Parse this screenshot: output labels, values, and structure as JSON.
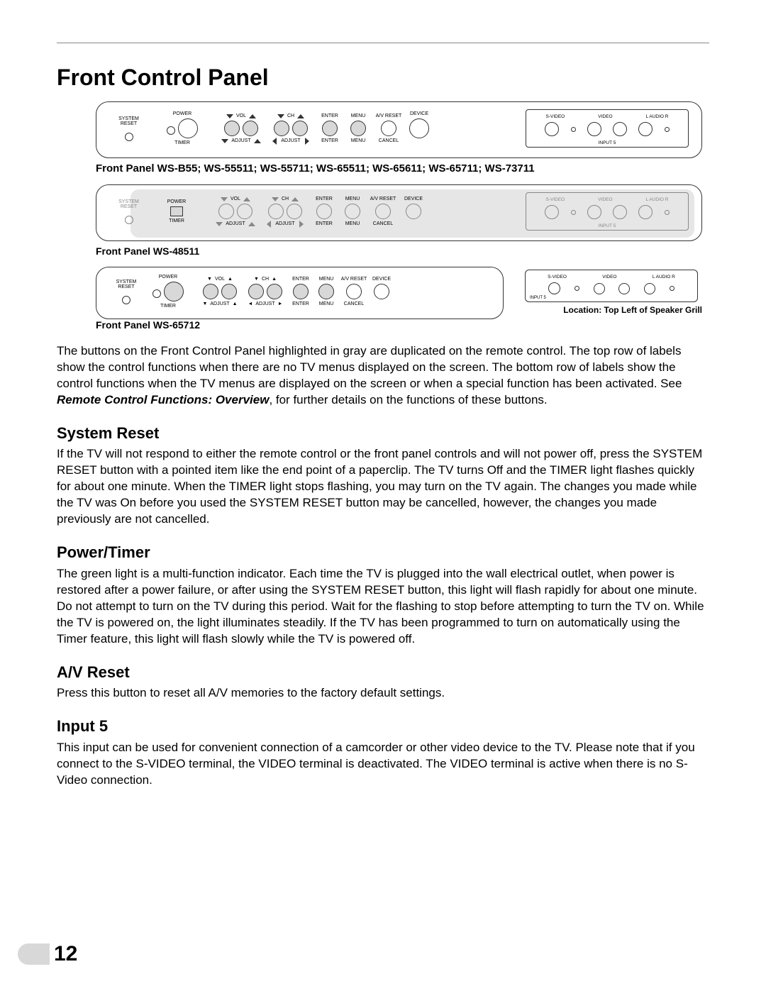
{
  "page_number": "12",
  "main_title": "Front Control Panel",
  "panel1": {
    "caption": "Front Panel WS-B55; WS-55511; WS-55711; WS-65511; WS-65611; WS-65711; WS-73711",
    "system_reset": "SYSTEM\nRESET",
    "power": "POWER",
    "timer": "TIMER",
    "vol": "VOL",
    "ch": "CH",
    "adjust": "ADJUST",
    "enter": "ENTER",
    "menu": "MENU",
    "av_reset": "A/V RESET",
    "device": "DEVICE",
    "cancel": "CANCEL",
    "jacks": {
      "svideo": "S-VIDEO",
      "video": "VIDEO",
      "audio": "L  AUDIO  R",
      "input5": "INPUT 5"
    }
  },
  "panel2": {
    "caption": "Front Panel WS-48511"
  },
  "panel3": {
    "caption": "Front Panel  WS-65712",
    "location": "Location: Top Left of Speaker Grill"
  },
  "paragraphs": {
    "intro_a": "The buttons on the Front Control Panel highlighted in gray are duplicated on the remote control.  The top row of labels show the control functions when there are no TV menus displayed on the screen.  The bottom row of labels show the control functions when the TV menus are displayed on the screen or when a special function has been activated. See ",
    "intro_ref": "Remote Control Functions: Overview",
    "intro_b": ", for further details on the functions of these buttons."
  },
  "sections": {
    "system_reset": {
      "h": "System Reset",
      "p": "If the TV will not respond to either the remote control or the front panel controls and will not power off, press the SYSTEM RESET button with a pointed item like the end point of a paperclip.  The TV turns Off and the TIMER light flashes quickly for about one minute.  When the TIMER light stops flashing, you may turn on the TV again.  The changes you made while the TV was On before you used the SYSTEM RESET button may be cancelled, however, the changes you made previously are not cancelled."
    },
    "power_timer": {
      "h": "Power/Timer",
      "p": "The green light is a multi-function indicator.  Each time the TV is plugged into the wall electrical outlet, when power is restored after a power failure, or after using the SYSTEM RESET button, this light will flash rapidly for about one minute.  Do not attempt to turn on the TV during this period. Wait for the flashing to stop before attempting to turn the TV on.  While the TV is powered on, the light illuminates steadily.  If the TV has been programmed to turn on automatically using the Timer feature, this light will flash slowly while the TV is powered off."
    },
    "av_reset": {
      "h": "A/V Reset",
      "p": "Press this button to reset all A/V memories to the factory default settings."
    },
    "input5": {
      "h": "Input 5",
      "p": "This input can be used for convenient connection of a camcorder or other video device to the TV.  Please note that if you connect to the S-VIDEO terminal, the VIDEO terminal is deactivated.  The VIDEO terminal is active when there is no S-Video connection."
    }
  }
}
